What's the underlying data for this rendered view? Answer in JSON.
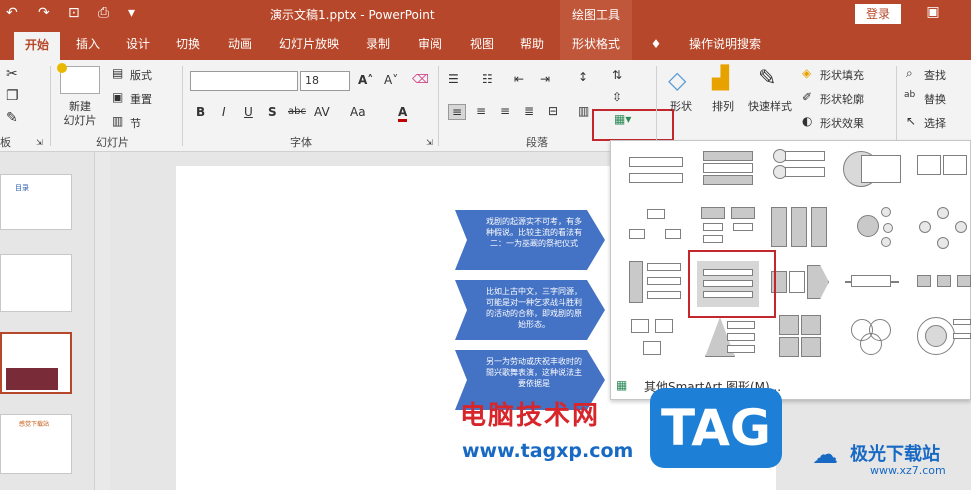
{
  "title_bar": {
    "document_title": "演示文稿1.pptx  -  PowerPoint",
    "context_group": "绘图工具",
    "login_label": "登录",
    "quick_access": [
      "undo-icon",
      "redo-icon",
      "present-icon",
      "save-icon",
      "customize-icon"
    ]
  },
  "tabs": [
    {
      "label": "开始",
      "active": true
    },
    {
      "label": "插入"
    },
    {
      "label": "设计"
    },
    {
      "label": "切换"
    },
    {
      "label": "动画"
    },
    {
      "label": "幻灯片放映"
    },
    {
      "label": "录制"
    },
    {
      "label": "审阅"
    },
    {
      "label": "视图"
    },
    {
      "label": "帮助"
    },
    {
      "label": "形状格式",
      "context": true
    },
    {
      "label": "操作说明搜索"
    }
  ],
  "ribbon": {
    "clipboard_group": "板",
    "slides_group": "幻灯片",
    "font_group": "字体",
    "paragraph_group": "段落",
    "new_slide_label": "新建\n幻灯片",
    "layout_label": "版式",
    "reset_label": "重置",
    "section_label": "节",
    "font_name": "",
    "font_size": "18",
    "shape_label": "形状",
    "arrange_label": "排列",
    "quick_style_label": "快速样式",
    "fill_label": "形状填充",
    "outline_label": "形状轮廓",
    "effect_label": "形状效果",
    "find_label": "查找",
    "replace_label": "替换",
    "select_label": "选择",
    "format_buttons": [
      "B",
      "I",
      "U",
      "S",
      "abc",
      "AV",
      "Aa",
      "A"
    ]
  },
  "thumbs": [
    {
      "label": "目录"
    },
    {
      "label": ""
    },
    {
      "label": ""
    },
    {
      "label": "感觉下载站"
    }
  ],
  "slide": {
    "chevrons": [
      "戏剧的起源实不可考，有多种假说。比较主流的看法有二：一为巫觋的祭祀仪式",
      "比如上古中文，三字同源，可能是对一种乞求战斗胜利的活动的合称，即戏剧的原始形态。",
      "另一为劳动或庆祝丰收时的閒兴歌舞表演，这种说法主要依据是"
    ]
  },
  "gallery": {
    "more_label": "其他SmartArt 图形(M)..."
  },
  "watermark": {
    "site_cn": "电脑技术网",
    "site_url": "www.tagxp.com",
    "tag_logo": "TAG",
    "brand": "极光下载站",
    "brand_url": "www.xz7.com"
  },
  "colors": {
    "accent": "#b7472a",
    "chevron": "#4472c4",
    "highlight": "#c1272d"
  }
}
